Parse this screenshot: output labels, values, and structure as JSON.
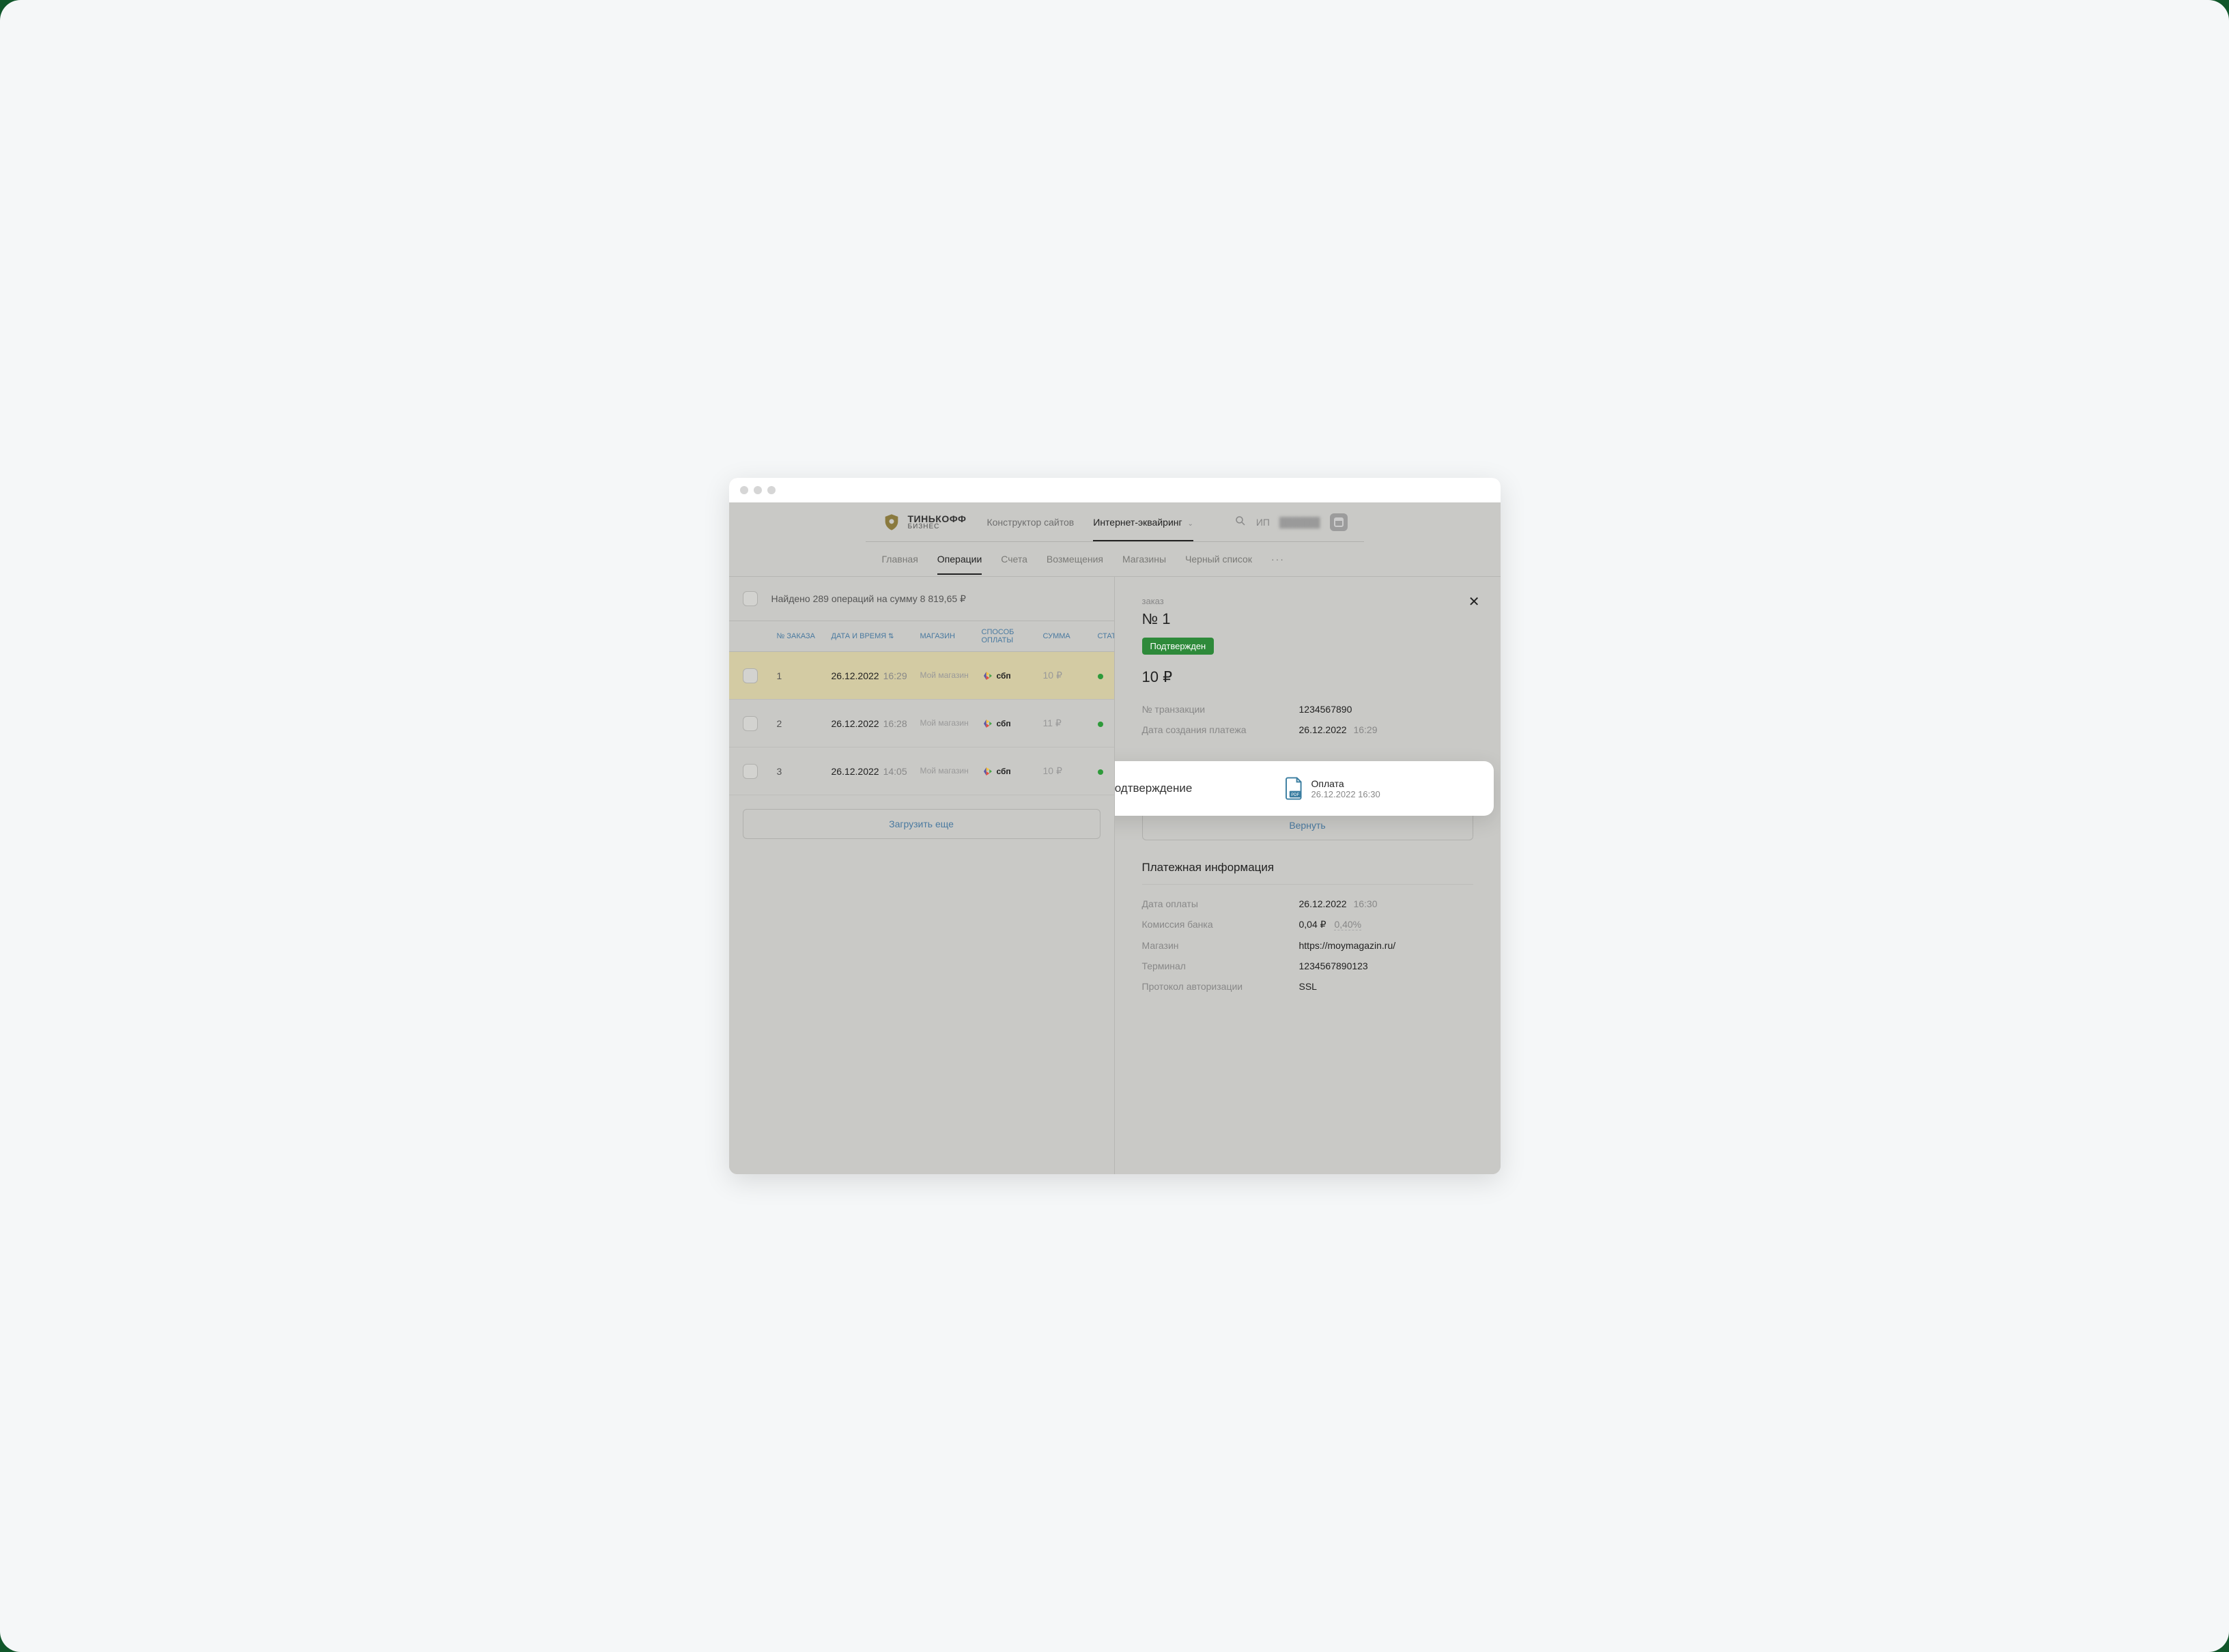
{
  "brand": {
    "line1": "ТИНЬКОФФ",
    "line2": "БИЗНЕС"
  },
  "topnav": {
    "site_builder": "Конструктор сайтов",
    "acquiring": "Интернет-эквайринг"
  },
  "user_prefix": "ИП",
  "subnav": {
    "home": "Главная",
    "operations": "Операции",
    "invoices": "Счета",
    "refunds": "Возмещения",
    "shops": "Магазины",
    "blacklist": "Черный список"
  },
  "summary_text": "Найдено 289 операций на сумму 8 819,65 ₽",
  "columns": {
    "order_no": "№ ЗАКАЗА",
    "datetime": "ДАТА И ВРЕМЯ",
    "shop": "МАГАЗИН",
    "pay_method": "СПОСОБ ОПЛАТЫ",
    "sum": "СУММА",
    "status": "СТАТУС"
  },
  "rows": [
    {
      "order": "1",
      "date": "26.12.2022",
      "time": "16:29",
      "shop": "Мой магазин",
      "method": "сбп",
      "sum": "10 ₽"
    },
    {
      "order": "2",
      "date": "26.12.2022",
      "time": "16:28",
      "shop": "Мой магазин",
      "method": "сбп",
      "sum": "11 ₽"
    },
    {
      "order": "3",
      "date": "26.12.2022",
      "time": "14:05",
      "shop": "Мой магазин",
      "method": "сбп",
      "sum": "10 ₽"
    }
  ],
  "load_more": "Загрузить еще",
  "details": {
    "order_label": "заказ",
    "order_number": "№ 1",
    "status_badge": "Подтвержден",
    "amount": "10 ₽",
    "txn_label": "№ транзакции",
    "txn_value": "1234567890",
    "created_label": "Дата создания платежа",
    "created_date": "26.12.2022",
    "created_time": "16:29",
    "confirm_title": "Подтверждение",
    "pdf_title": "Оплата",
    "pdf_sub": "26.12.2022 16:30",
    "refund_btn": "Вернуть",
    "section_title": "Платежная информация",
    "pay_date_label": "Дата оплаты",
    "pay_date": "26.12.2022",
    "pay_time": "16:30",
    "fee_label": "Комиссия банка",
    "fee_value": "0,04 ₽",
    "fee_pct": "0,40%",
    "shop_label": "Магазин",
    "shop_value": "https://moymagazin.ru/",
    "terminal_label": "Терминал",
    "terminal_value": "1234567890123",
    "proto_label": "Протокол авторизации",
    "proto_value": "SSL"
  }
}
